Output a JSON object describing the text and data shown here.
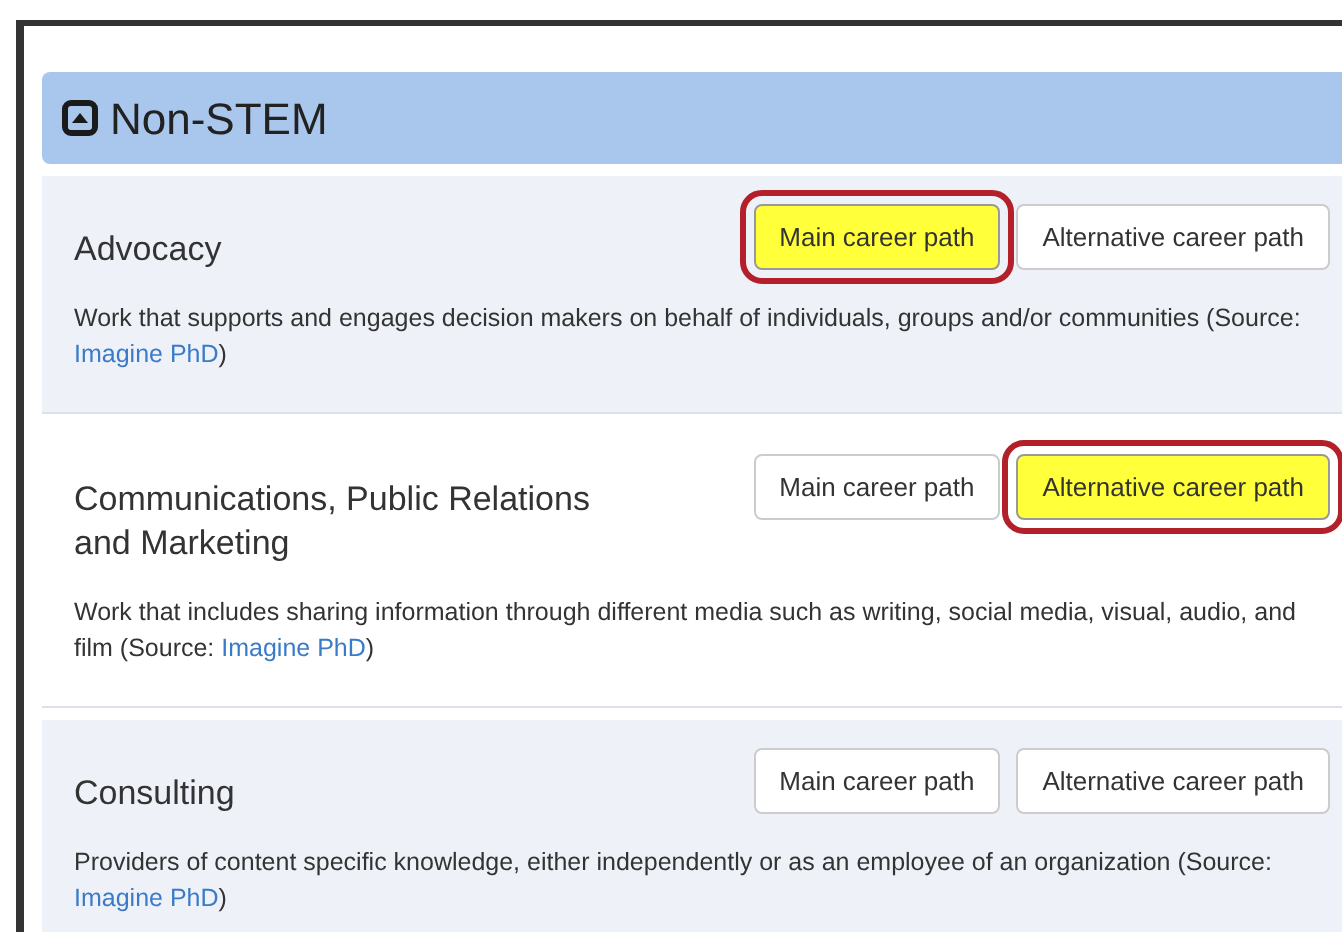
{
  "panel": {
    "title": "Non-STEM",
    "expanded": true
  },
  "careers": [
    {
      "name": "Advocacy",
      "description": "Work that supports and engages decision makers on behalf of individuals, groups and/or communities (Source: ",
      "link": "Imagine PhD",
      "closing": ")",
      "buttons": [
        {
          "label": "Main career path",
          "selected": true
        },
        {
          "label": "Alternative career path",
          "selected": false
        }
      ]
    },
    {
      "name": "Communications, Public Relations and Marketing",
      "description": "Work that includes sharing information through different media such as writing, social media, visual, audio, and film (Source: ",
      "link": "Imagine PhD",
      "closing": ")",
      "buttons": [
        {
          "label": "Main career path",
          "selected": false
        },
        {
          "label": "Alternative career path",
          "selected": true
        }
      ]
    },
    {
      "name": "Consulting",
      "description": "Providers of content specific knowledge, either independently or as an employee of an organization (Source: ",
      "link": "Imagine PhD",
      "closing": ")",
      "buttons": [
        {
          "label": "Main career path",
          "selected": false
        },
        {
          "label": "Alternative career path",
          "selected": false
        }
      ]
    }
  ]
}
